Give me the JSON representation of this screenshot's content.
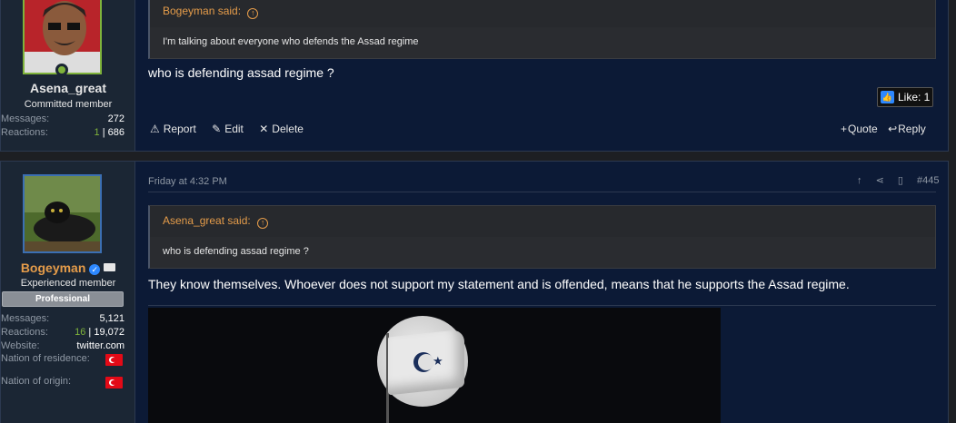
{
  "post1": {
    "user": {
      "name": "Asena_great",
      "title": "Committed member",
      "stats": [
        {
          "label": "Messages:",
          "value": "272"
        },
        {
          "label": "Reactions:",
          "value_green": "1",
          "value_rest": " | 686"
        }
      ]
    },
    "quote": {
      "author": "Bogeyman said:",
      "arrow": "↑",
      "text": "I'm talking about everyone who defends the Assad regime"
    },
    "text": "who is defending assad regime ?",
    "like": {
      "icon": "👍",
      "label": "Like: 1"
    },
    "actions_left": [
      {
        "icon": "⚠",
        "label": "Report"
      },
      {
        "icon": "✎",
        "label": "Edit"
      },
      {
        "icon": "✕",
        "label": "Delete"
      }
    ],
    "actions_right": [
      {
        "icon": "+",
        "label": "Quote"
      },
      {
        "icon": "↩",
        "label": "Reply"
      }
    ]
  },
  "post2": {
    "user": {
      "name": "Bogeyman",
      "badge_icon": "verified-badge-icon",
      "mail_icon": "envelope-icon",
      "title": "Experienced member",
      "banner": "Professional",
      "stats": [
        {
          "label": "Messages:",
          "value": "5,121"
        },
        {
          "label": "Reactions:",
          "value_green": "16",
          "value_rest": " | 19,072"
        },
        {
          "label": "Website:",
          "value": "twitter.com"
        },
        {
          "label": "Nation of residence:",
          "flag": "turkey-flag-icon"
        },
        {
          "label": "Nation of origin:",
          "flag": "turkey-flag-icon"
        }
      ]
    },
    "date": "Friday at 4:32 PM",
    "post_number": "#445",
    "quote": {
      "author": "Asena_great said:",
      "arrow": "↑",
      "text": "who is defending assad regime ?"
    },
    "text": "They know themselves. Whoever does not support my statement and is offended, means that he supports the Assad regime."
  }
}
